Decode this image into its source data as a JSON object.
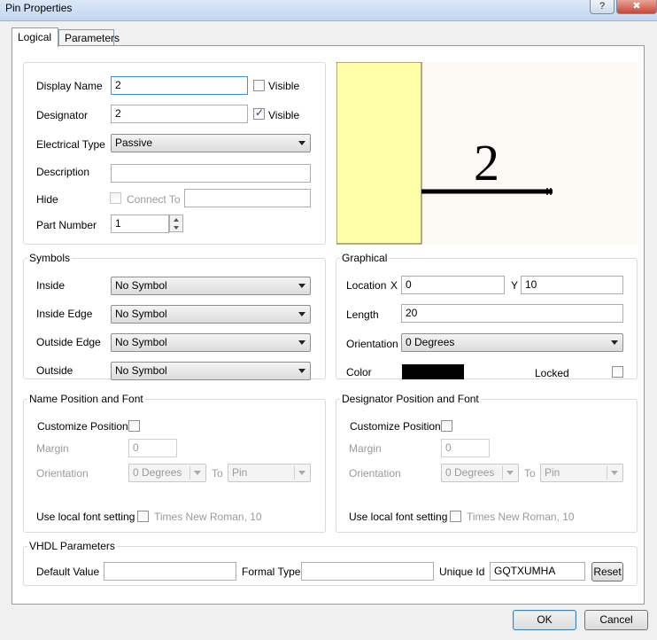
{
  "window": {
    "title": "Pin Properties",
    "help_glyph": "?",
    "close_glyph": "✖"
  },
  "tabs": [
    {
      "label": "Logical"
    },
    {
      "label": "Parameters"
    }
  ],
  "properties": {
    "display_name_label": "Display Name",
    "display_name_value": "2",
    "display_name_visible_label": "Visible",
    "display_name_visible": false,
    "designator_label": "Designator",
    "designator_value": "2",
    "designator_visible_label": "Visible",
    "designator_visible": true,
    "electrical_type_label": "Electrical Type",
    "electrical_type_value": "Passive",
    "description_label": "Description",
    "description_value": "",
    "hide_label": "Hide",
    "connect_to_label": "Connect To",
    "connect_to_value": "",
    "part_number_label": "Part Number",
    "part_number_value": "1"
  },
  "preview": {
    "pin_text": "2",
    "body_color": "#ffffa8",
    "bg_color": "#fcf8f3"
  },
  "symbols": {
    "legend": "Symbols",
    "rows": [
      {
        "label": "Inside",
        "value": "No Symbol"
      },
      {
        "label": "Inside Edge",
        "value": "No Symbol"
      },
      {
        "label": "Outside Edge",
        "value": "No Symbol"
      },
      {
        "label": "Outside",
        "value": "No Symbol"
      }
    ]
  },
  "graphical": {
    "legend": "Graphical",
    "location_label": "Location",
    "x_label": "X",
    "x_value": "0",
    "y_label": "Y",
    "y_value": "10",
    "length_label": "Length",
    "length_value": "20",
    "orientation_label": "Orientation",
    "orientation_value": "0 Degrees",
    "color_label": "Color",
    "color_value": "#000000",
    "locked_label": "Locked"
  },
  "name_font": {
    "legend": "Name Position and Font",
    "customize_label": "Customize Position",
    "margin_label": "Margin",
    "margin_value": "0",
    "orientation_label": "Orientation",
    "orientation_value": "0 Degrees",
    "to_label": "To",
    "to_value": "Pin",
    "local_font_label": "Use local font setting",
    "font_value": "Times New Roman, 10"
  },
  "designator_font": {
    "legend": "Designator Position and Font",
    "customize_label": "Customize Position",
    "margin_label": "Margin",
    "margin_value": "0",
    "orientation_label": "Orientation",
    "orientation_value": "0 Degrees",
    "to_label": "To",
    "to_value": "Pin",
    "local_font_label": "Use local font setting",
    "font_value": "Times New Roman, 10"
  },
  "vhdl": {
    "legend": "VHDL Parameters",
    "default_label": "Default Value",
    "default_value": "",
    "formal_label": "Formal Type",
    "formal_value": "",
    "unique_label": "Unique Id",
    "unique_value": "GQTXUMHA",
    "reset_label": "Reset"
  },
  "footer": {
    "ok_label": "OK",
    "cancel_label": "Cancel"
  }
}
